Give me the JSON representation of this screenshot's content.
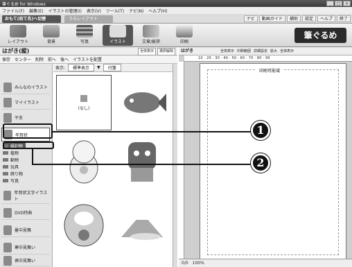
{
  "window": {
    "title": "筆ぐるめ for Windows",
    "controls": [
      "_",
      "□",
      "×"
    ]
  },
  "menu": [
    "ファイル(F)",
    "編集(E)",
    "イラストの管理(I)",
    "表示(V)",
    "ツール(T)",
    "ナビ(N)",
    "ヘルプ(H)"
  ],
  "tabs": {
    "active": "おもて(宛て名)へ切替",
    "inactive": "うらレイアウト"
  },
  "tab_right": [
    "ナビ",
    "動画ガイド",
    "補助",
    "設定",
    "ヘルプ",
    "終了"
  ],
  "toolbar": [
    {
      "label": "レイアウト"
    },
    {
      "label": "背景"
    },
    {
      "label": "写真"
    },
    {
      "label": "イラスト",
      "active": true
    },
    {
      "label": "文章/挨拶"
    },
    {
      "label": "印刷"
    }
  ],
  "logo": "筆ぐるめ",
  "left_panel": {
    "title": "はがき(縦)",
    "title_buttons": [
      "全体表示",
      "選択解除"
    ],
    "tools": [
      "保存",
      "センター",
      "削除",
      "前へ",
      "後へ",
      "イラストを配置"
    ],
    "categories": [
      {
        "label": "みんなのイラスト"
      },
      {
        "label": "マイイラスト"
      },
      {
        "label": "干支"
      },
      {
        "label": "年賀状",
        "selected": true
      }
    ],
    "subfolders": [
      {
        "label": "縁起物",
        "selected": true
      },
      {
        "label": "植物"
      },
      {
        "label": "動物"
      },
      {
        "label": "玩具"
      },
      {
        "label": "飾り物"
      },
      {
        "label": "写真"
      }
    ],
    "more_categories": [
      {
        "label": "年賀状文字イラスト"
      },
      {
        "label": "DVD特典"
      },
      {
        "label": "暑中見舞"
      },
      {
        "label": "寒中見舞い"
      },
      {
        "label": "喪中見舞い"
      }
    ],
    "gallery_bar": {
      "label": "表示:",
      "view": "標準表示",
      "sort": "付箋"
    },
    "gallery_items": [
      "(なし)"
    ]
  },
  "right_panel": {
    "title": "はがき",
    "title_buttons": [
      "全体表示",
      "印刷範囲",
      "詳細設定",
      "拡大",
      "全体表示"
    ],
    "ruler": "10 · 20 · 30 · 40 · 50 · 60 · 70 · 80 · 90",
    "printable_label": "印刷可能域",
    "status": {
      "page": "0/0",
      "zoom": "100%"
    }
  },
  "callouts": [
    "1",
    "2"
  ],
  "colors": {
    "callout": "#111111",
    "selected_tab": "#555555",
    "panel_bg": "#cfcfcf"
  }
}
